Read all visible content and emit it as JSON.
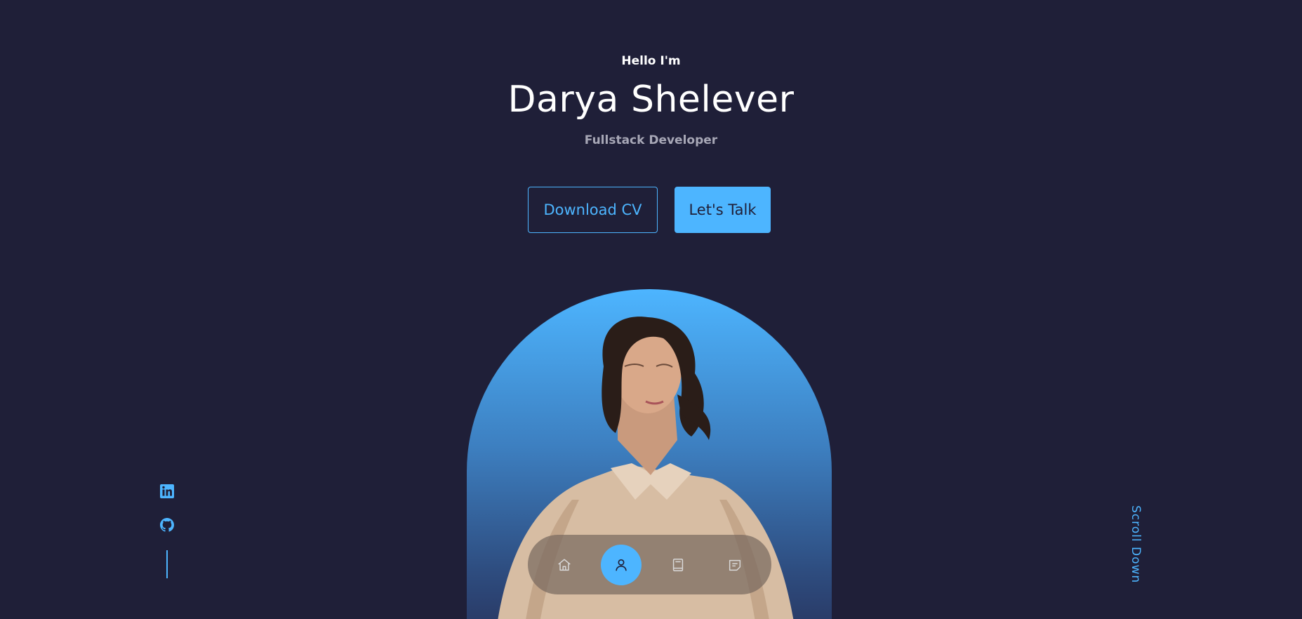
{
  "hero": {
    "greeting": "Hello I'm",
    "name": "Darya Shelever",
    "role": "Fullstack Developer"
  },
  "cta": {
    "download_cv": "Download CV",
    "lets_talk": "Let's Talk"
  },
  "socials": [
    {
      "icon": "linkedin-icon"
    },
    {
      "icon": "github-icon"
    }
  ],
  "scroll_down": "Scroll Down",
  "nav": {
    "items": [
      {
        "icon": "home-icon",
        "active": false
      },
      {
        "icon": "user-icon",
        "active": true
      },
      {
        "icon": "book-icon",
        "active": false
      },
      {
        "icon": "message-icon",
        "active": false
      }
    ]
  },
  "colors": {
    "background": "#1f1f38",
    "accent": "#4db5ff",
    "muted_text": "#a7a7b6"
  }
}
